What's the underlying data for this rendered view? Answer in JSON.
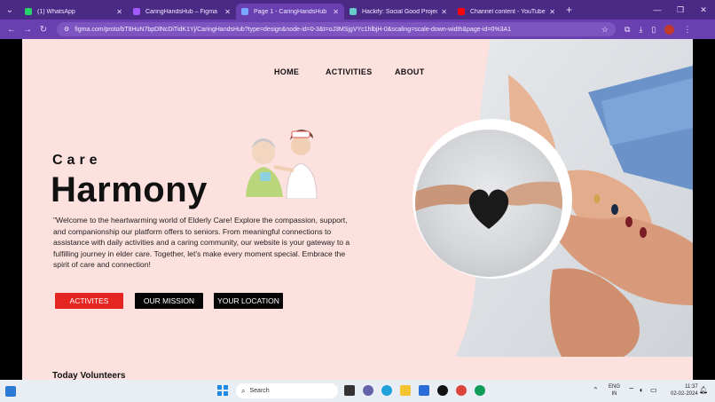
{
  "browser": {
    "tabs": [
      {
        "label": "(1) WhatsApp",
        "color": "#25d366",
        "active": false
      },
      {
        "label": "CaringHandsHub – Figma",
        "color": "#a259ff",
        "active": false
      },
      {
        "label": "Page 1 - CaringHandsHub",
        "color": "#7aa7ff",
        "active": true
      },
      {
        "label": "Hackify: Social Good Projects",
        "color": "#6cc",
        "active": false
      },
      {
        "label": "Channel content - YouTube Stu",
        "color": "#ff0000",
        "active": false
      }
    ],
    "url": "figma.com/proto/bT8HuN7bpDlNcDiTidK1Yj/CaringHandsHub?type=design&node-id=0-3&t=oJ3MSjgVYc1hlbjH-0&scaling=scale-down-width&page-id=0%3A1"
  },
  "site": {
    "nav": {
      "home": "HOME",
      "activities": "ACTIVITIES",
      "about": "ABOUT"
    },
    "hero": {
      "care": "Care",
      "harmony": "Harmony",
      "description": "\"Welcome to the heartwarming world of Elderly Care! Explore the compassion, support, and companionship our platform offers to seniors. From meaningful connections to assistance with daily activities and a caring community, our website is your gateway to a fulfilling journey in elder care. Together, let's make every moment special. Embrace the spirit of care and connection!"
    },
    "buttons": {
      "activities": "ACTIVITES",
      "mission": "OUR MISSION",
      "location": "YOUR LOCATION"
    },
    "volunteers_heading": "Today Volunteers"
  },
  "taskbar": {
    "search_placeholder": "Search",
    "lang_top": "ENG",
    "lang_bottom": "IN",
    "time": "11:37",
    "date": "02-02-2024"
  },
  "colors": {
    "page_bg": "#fce1df",
    "accent_red": "#e52522",
    "browser_purple": "#4b2a86"
  }
}
